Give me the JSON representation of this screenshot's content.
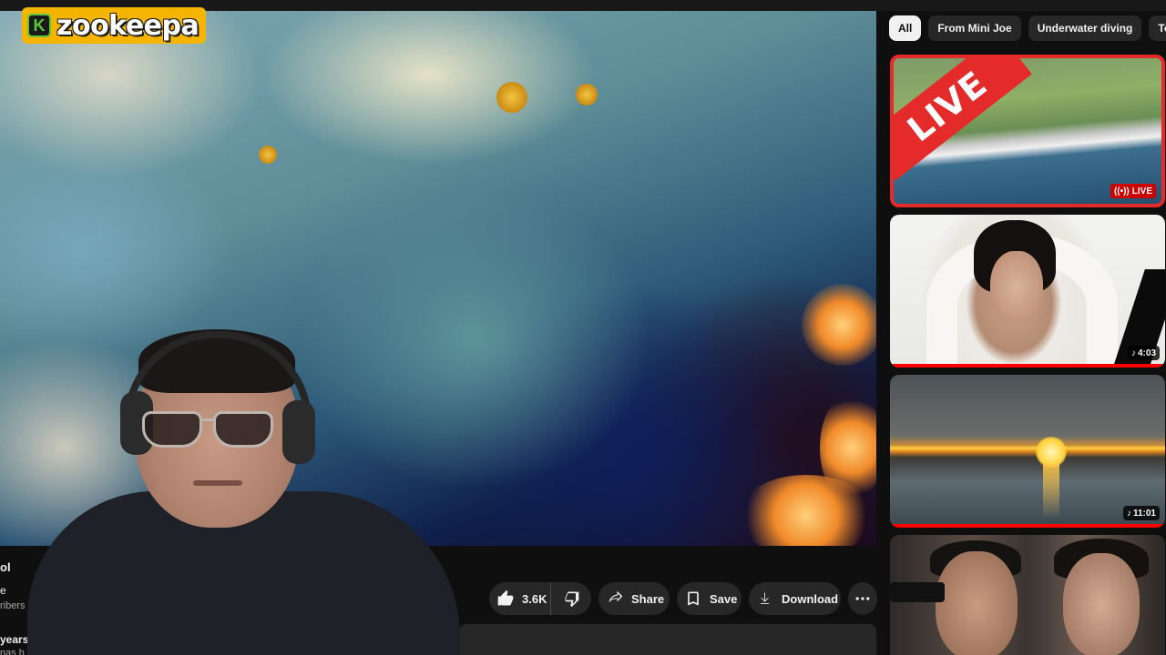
{
  "logo": {
    "badge": "K",
    "text": "zookeepa"
  },
  "player": {
    "description": "underwater cave video frame with webcam overlay of streamer"
  },
  "actions": {
    "like_count": "3.6K",
    "share_label": "Share",
    "save_label": "Save",
    "download_label": "Download"
  },
  "channel_fragments": [
    "ol",
    "e",
    "ribers",
    "years",
    "nas h"
  ],
  "chips": [
    "All",
    "From Mini Joe",
    "Underwater diving",
    "Touris"
  ],
  "recommendations": [
    {
      "badge": "LIVE",
      "banner": "LIVE",
      "progress": 1.0
    },
    {
      "duration": "4:03",
      "progress": 1.0
    },
    {
      "duration": "11:01",
      "progress": 1.0
    },
    {
      "duration": ""
    }
  ],
  "colors": {
    "accent": "#ff0000",
    "live": "#e52a2a",
    "logo_bg": "#f4b400",
    "logo_green": "#58c83a"
  }
}
